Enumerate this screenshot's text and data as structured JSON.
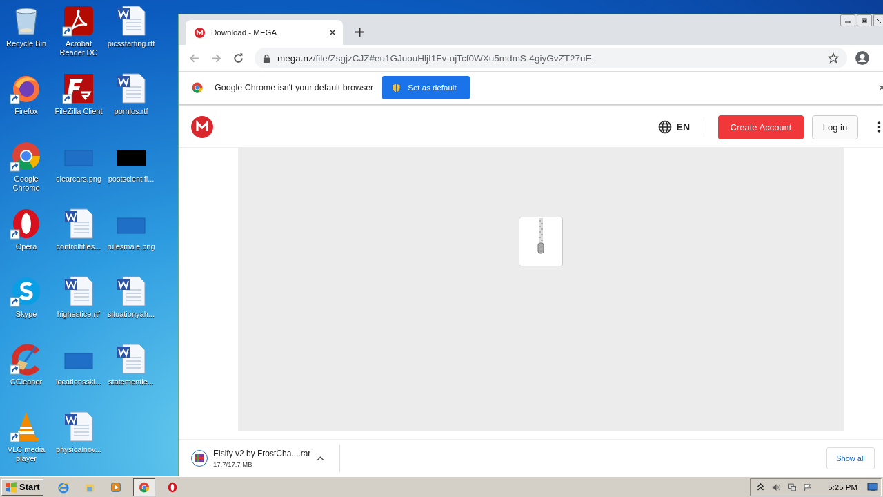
{
  "desktop": {
    "icons": [
      {
        "label": "Recycle Bin",
        "kind": "recycle",
        "shortcut": false
      },
      {
        "label": "Firefox",
        "kind": "firefox",
        "shortcut": true
      },
      {
        "label": "Google Chrome",
        "kind": "chrome",
        "shortcut": true
      },
      {
        "label": "Opera",
        "kind": "opera",
        "shortcut": true
      },
      {
        "label": "Skype",
        "kind": "skype",
        "shortcut": true
      },
      {
        "label": "CCleaner",
        "kind": "ccleaner",
        "shortcut": true
      },
      {
        "label": "VLC media player",
        "kind": "vlc",
        "shortcut": true
      },
      {
        "label": "Acrobat Reader DC",
        "kind": "acrobat",
        "shortcut": true
      },
      {
        "label": "FileZilla Client",
        "kind": "filezilla",
        "shortcut": true
      },
      {
        "label": "clearcars.png",
        "kind": "image",
        "shortcut": false
      },
      {
        "label": "controltitles...",
        "kind": "word",
        "shortcut": false
      },
      {
        "label": "highestice.rtf",
        "kind": "word",
        "shortcut": false
      },
      {
        "label": "locationsski...",
        "kind": "image",
        "shortcut": false
      },
      {
        "label": "physicalnov...",
        "kind": "word",
        "shortcut": false
      },
      {
        "label": "picsstarting.rtf",
        "kind": "word",
        "shortcut": false
      },
      {
        "label": "pornlos.rtf",
        "kind": "word",
        "shortcut": false
      },
      {
        "label": "postscientifi...",
        "kind": "image_dark",
        "shortcut": false
      },
      {
        "label": "rulesmale.png",
        "kind": "image",
        "shortcut": false
      },
      {
        "label": "situationyah...",
        "kind": "word",
        "shortcut": false
      },
      {
        "label": "statementle...",
        "kind": "word",
        "shortcut": false
      }
    ]
  },
  "browser": {
    "tab": {
      "title": "Download - MEGA"
    },
    "url": {
      "host": "mega.nz",
      "path": "/file/ZsgjzCJZ#eu1GJuouHljI1Fv-ujTcf0WXu5mdmS-4giyGvZT27uE"
    },
    "infobar": {
      "text": "Google Chrome isn't your default browser",
      "button": "Set as default"
    },
    "page": {
      "language": "EN",
      "create_account": "Create Account",
      "log_in": "Log in"
    },
    "download": {
      "name": "Elsify v2 by FrostCha....rar",
      "size": "17.7/17.7 MB"
    },
    "show_all": "Show all"
  },
  "taskbar": {
    "start": "Start",
    "apps": [
      {
        "kind": "ie",
        "selected": false
      },
      {
        "kind": "explorer",
        "selected": false
      },
      {
        "kind": "media",
        "selected": false
      },
      {
        "kind": "chrome",
        "selected": true
      },
      {
        "kind": "opera",
        "selected": false
      }
    ],
    "clock": "5:25 PM"
  }
}
